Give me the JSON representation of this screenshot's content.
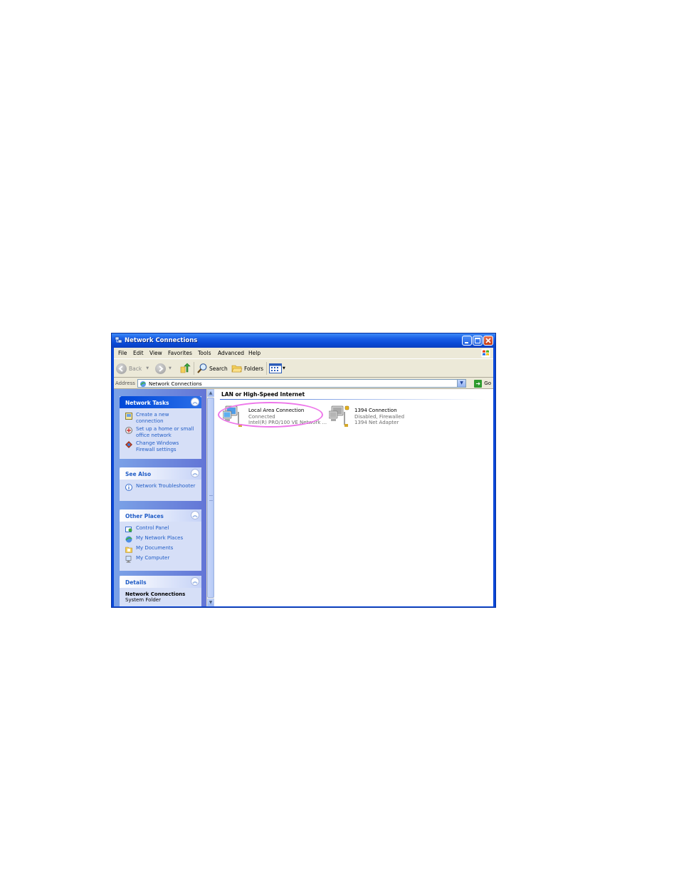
{
  "window": {
    "title": "Network Connections"
  },
  "menu": [
    {
      "key": "F",
      "rest": "ile"
    },
    {
      "key": "E",
      "rest": "dit"
    },
    {
      "key": "V",
      "rest": "iew"
    },
    {
      "key": "",
      "rest": "Favorites",
      "prefix": "F",
      "underline_index": 1
    },
    {
      "key": "T",
      "rest": "ools"
    },
    {
      "key": "",
      "rest": "Advanced"
    },
    {
      "key": "H",
      "rest": "elp"
    }
  ],
  "menu_labels": {
    "file": "File",
    "edit": "Edit",
    "view": "View",
    "favorites": "Favorites",
    "tools": "Tools",
    "advanced": "Advanced",
    "help": "Help"
  },
  "toolbar": {
    "back": "Back",
    "search": "Search",
    "folders": "Folders"
  },
  "address": {
    "label": "Address",
    "value": "Network Connections",
    "go": "Go"
  },
  "tasks": {
    "network_tasks": {
      "title": "Network Tasks",
      "items": [
        {
          "label": "Create a new connection",
          "icon": "new-connection-icon"
        },
        {
          "label": "Set up a home or small office network",
          "icon": "home-network-icon"
        },
        {
          "label": "Change Windows Firewall settings",
          "icon": "firewall-icon"
        }
      ]
    },
    "see_also": {
      "title": "See Also",
      "items": [
        {
          "label": "Network Troubleshooter",
          "icon": "info-icon"
        }
      ]
    },
    "other_places": {
      "title": "Other Places",
      "items": [
        {
          "label": "Control Panel",
          "icon": "control-panel-icon"
        },
        {
          "label": "My Network Places",
          "icon": "network-places-icon"
        },
        {
          "label": "My Documents",
          "icon": "documents-icon"
        },
        {
          "label": "My Computer",
          "icon": "computer-icon"
        }
      ]
    },
    "details": {
      "title": "Details",
      "name": "Network Connections",
      "type": "System Folder"
    }
  },
  "content": {
    "group": "LAN or High-Speed Internet",
    "connections": [
      {
        "name": "Local Area Connection",
        "status": "Connected",
        "device": "Intel(R) PRO/100 VE Network ..."
      },
      {
        "name": "1394 Connection",
        "status": "Disabled, Firewalled",
        "device": "1394 Net Adapter"
      }
    ]
  },
  "colors": {
    "titlebar": "#0a4ad6",
    "task_pane": "#7ba2e7",
    "link": "#215dc6",
    "highlight_ellipse": "#ee76ea"
  }
}
